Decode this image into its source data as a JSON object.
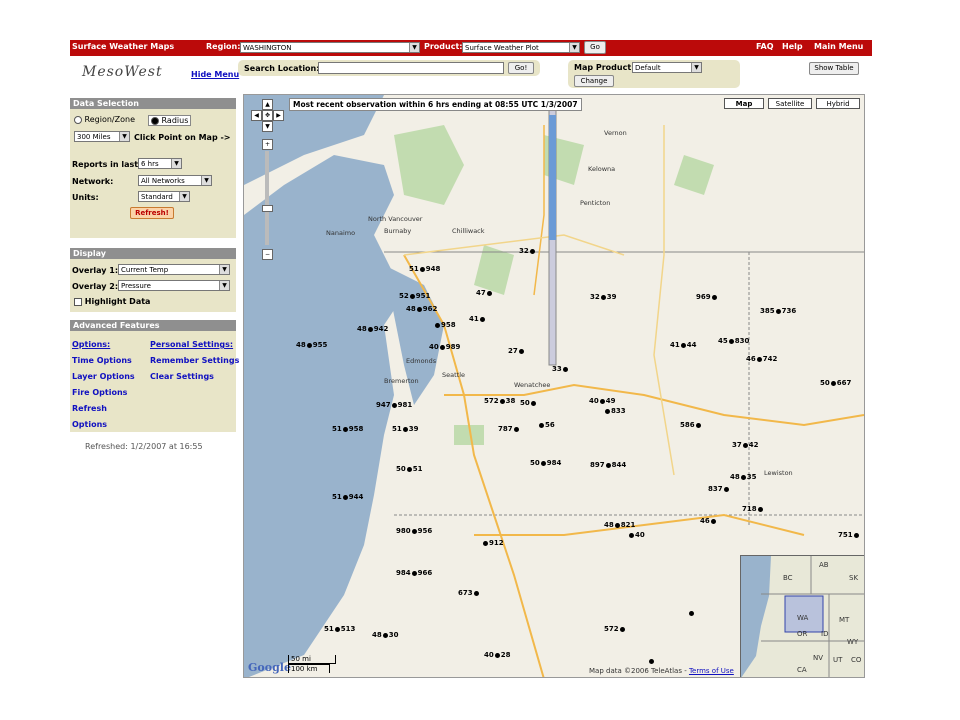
{
  "topbar": {
    "app_title": "Surface Weather Maps",
    "region_label": "Region:",
    "region_value": "WASHINGTON",
    "product_label": "Product:",
    "product_value": "Surface Weather Plot",
    "go_label": "Go",
    "faq": "FAQ",
    "help": "Help",
    "main_menu": "Main Menu"
  },
  "logo": {
    "text": "MesoWest"
  },
  "hide_menu": "Hide Menu",
  "search": {
    "label": "Search Location:",
    "value": "",
    "go_label": "Go!"
  },
  "map_product": {
    "label": "Map Product:",
    "value": "Default",
    "change_label": "Change"
  },
  "show_table": "Show Table",
  "data_selection": {
    "title": "Data Selection",
    "region_zone": "Region/Zone",
    "radius": "Radius",
    "radius_value": "300 Miles",
    "click_point": "Click Point on Map ->",
    "reports_label": "Reports in last:",
    "reports_value": "6 hrs",
    "network_label": "Network:",
    "network_value": "All Networks",
    "units_label": "Units:",
    "units_value": "Standard",
    "refresh": "Refresh!"
  },
  "display": {
    "title": "Display",
    "overlay1_label": "Overlay 1:",
    "overlay1_value": "Current Temp",
    "overlay2_label": "Overlay 2:",
    "overlay2_value": "Pressure",
    "highlight": "Highlight Data"
  },
  "advanced": {
    "title": "Advanced Features",
    "options": "Options:",
    "personal": "Personal Settings:",
    "time_options": "Time Options",
    "remember": "Remember Settings",
    "layer_options": "Layer Options",
    "clear": "Clear Settings",
    "fire_options": "Fire Options",
    "refresh": "Refresh",
    "options2": "Options"
  },
  "refreshed": "Refreshed: 1/2/2007 at 16:55",
  "map": {
    "banner": "Most recent observation within 6 hrs ending at 08:55 UTC 1/3/2007",
    "map_btn": "Map",
    "satellite_btn": "Satellite",
    "hybrid_btn": "Hybrid",
    "scale_mi": "50 mi",
    "scale_km": "100 km",
    "attribution": "Map data ©2006 TeleAtlas -",
    "terms": "Terms of Use",
    "google": "Google",
    "inset_labels": [
      "BC",
      "AB",
      "SK",
      "WA",
      "MT",
      "OR",
      "ID",
      "WY",
      "NV",
      "UT",
      "CO",
      "CA"
    ],
    "cities": [
      "North Vancouver",
      "Burnaby",
      "Chilliwack",
      "Nanaimo",
      "Vernon",
      "Kelowna",
      "Penticton",
      "Edmonds",
      "Seattle",
      "Bremerton",
      "Wenatchee",
      "Lewiston"
    ],
    "stations": [
      "32",
      "51",
      "948",
      "47",
      "52",
      "951",
      "48",
      "962",
      "958",
      "41",
      "942",
      "955",
      "40",
      "989",
      "27",
      "33",
      "572",
      "38",
      "50",
      "947",
      "981",
      "958",
      "39",
      "787",
      "56",
      "897",
      "844",
      "833",
      "49",
      "586",
      "984",
      "944",
      "51",
      "980",
      "956",
      "912",
      "821",
      "40",
      "837",
      "35",
      "46",
      "718",
      "37",
      "42",
      "751",
      "385",
      "736",
      "667",
      "742",
      "44",
      "830",
      "45",
      "969",
      "39",
      "984",
      "966",
      "673",
      "513",
      "30",
      "28"
    ]
  }
}
